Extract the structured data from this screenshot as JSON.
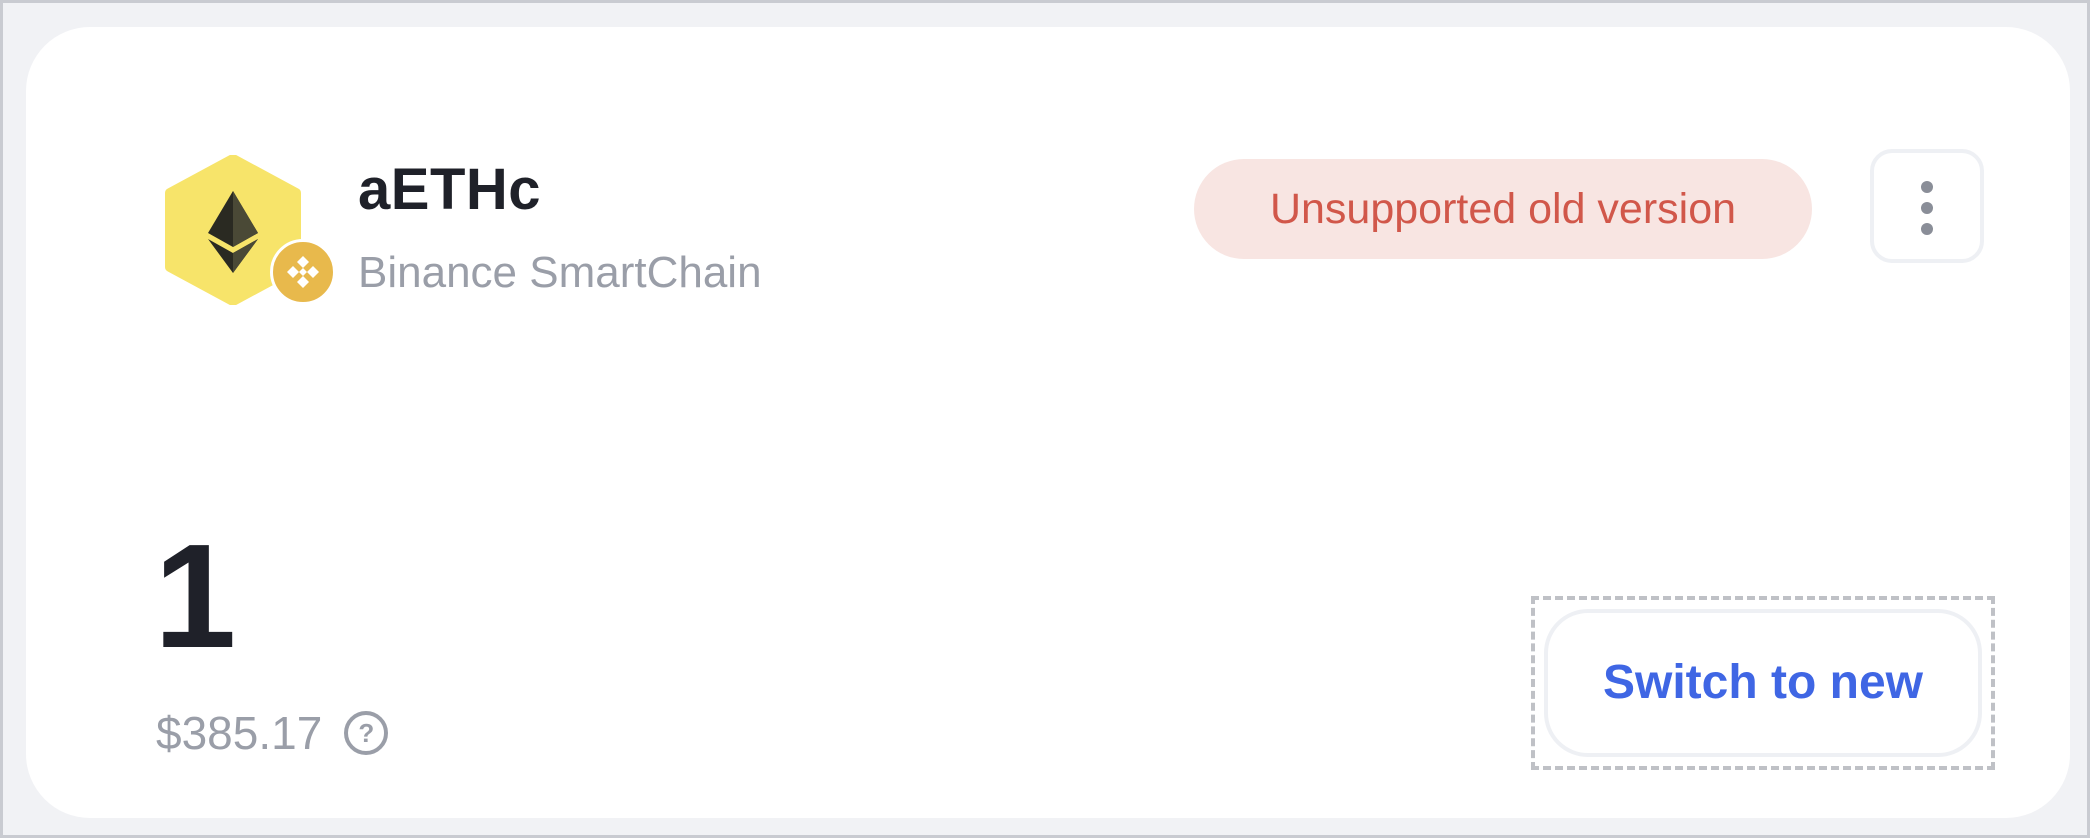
{
  "token": {
    "symbol": "aETHc",
    "network": "Binance SmartChain",
    "icon": "ethereum-icon",
    "chain_icon": "binance-icon"
  },
  "status": {
    "label": "Unsupported old version"
  },
  "balance": {
    "amount": "1",
    "fiat": "$385.17",
    "help_glyph": "?"
  },
  "actions": {
    "switch_label": "Switch to new",
    "menu_icon": "more-vertical-icon"
  },
  "colors": {
    "logo_bg": "#f7e46a",
    "chain_badge": "#e8b94c",
    "status_bg": "#f8e5e2",
    "status_text": "#d1574a",
    "button_text": "#3f66e4"
  }
}
